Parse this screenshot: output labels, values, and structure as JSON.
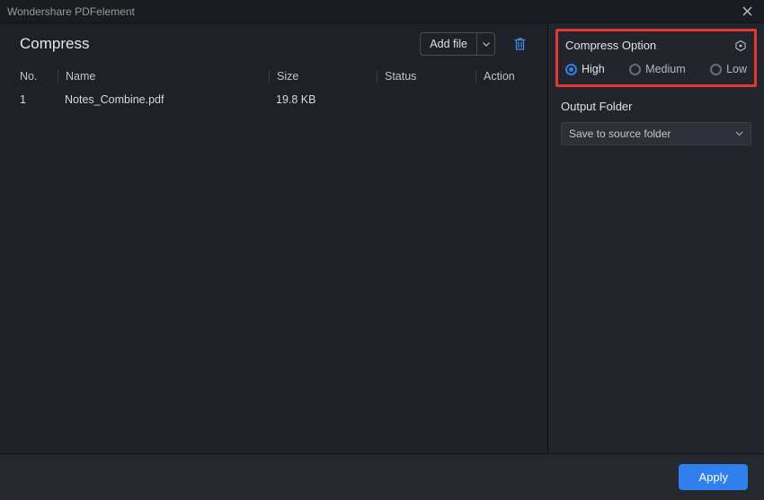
{
  "titlebar": {
    "app_name": "Wondershare PDFelement"
  },
  "main": {
    "title": "Compress",
    "add_file_label": "Add file",
    "columns": {
      "no": "No.",
      "name": "Name",
      "size": "Size",
      "status": "Status",
      "action": "Action"
    },
    "rows": [
      {
        "no": "1",
        "name": "Notes_Combine.pdf",
        "size": "19.8 KB",
        "status": "",
        "action": ""
      }
    ]
  },
  "options": {
    "header": "Compress Option",
    "levels": {
      "high": "High",
      "medium": "Medium",
      "low": "Low"
    },
    "selected": "high",
    "output_label": "Output Folder",
    "output_selected": "Save to source folder"
  },
  "footer": {
    "apply": "Apply"
  }
}
